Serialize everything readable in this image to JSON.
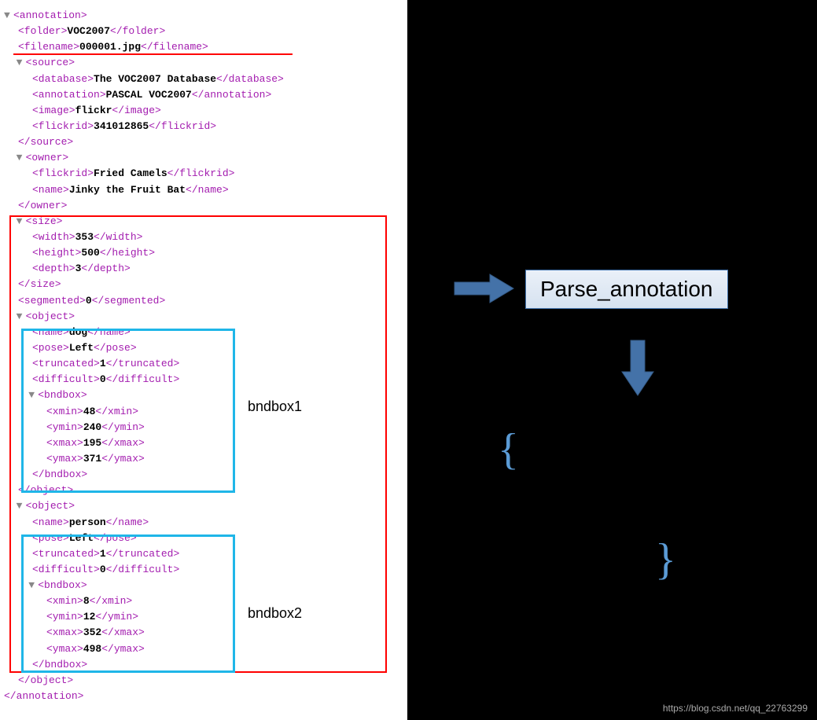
{
  "xml": {
    "root": {
      "open": "<annotation>",
      "close": "</annotation>"
    },
    "folder": {
      "open": "<folder>",
      "val": "VOC2007",
      "close": "</folder>"
    },
    "filename": {
      "open": "<filename>",
      "val": "000001.jpg",
      "close": "</filename>"
    },
    "source": {
      "open": "<source>",
      "close": "</source>",
      "database": {
        "open": "<database>",
        "val": "The VOC2007 Database",
        "close": "</database>"
      },
      "annotation": {
        "open": "<annotation>",
        "val": "PASCAL VOC2007",
        "close": "</annotation>"
      },
      "image": {
        "open": "<image>",
        "val": "flickr",
        "close": "</image>"
      },
      "flickrid": {
        "open": "<flickrid>",
        "val": "341012865",
        "close": "</flickrid>"
      }
    },
    "owner": {
      "open": "<owner>",
      "close": "</owner>",
      "flickrid": {
        "open": "<flickrid>",
        "val": "Fried Camels",
        "close": "</flickrid>"
      },
      "name": {
        "open": "<name>",
        "val": "Jinky the Fruit Bat",
        "close": "</name>"
      }
    },
    "size": {
      "open": "<size>",
      "close": "</size>",
      "width": {
        "open": "<width>",
        "val": "353",
        "close": "</width>"
      },
      "height": {
        "open": "<height>",
        "val": "500",
        "close": "</height>"
      },
      "depth": {
        "open": "<depth>",
        "val": "3",
        "close": "</depth>"
      }
    },
    "segmented": {
      "open": "<segmented>",
      "val": "0",
      "close": "</segmented>"
    },
    "object1": {
      "open": "<object>",
      "close": "</object>",
      "name": {
        "open": "<name>",
        "val": "dog",
        "close": "</name>"
      },
      "pose": {
        "open": "<pose>",
        "val": "Left",
        "close": "</pose>"
      },
      "truncated": {
        "open": "<truncated>",
        "val": "1",
        "close": "</truncated>"
      },
      "difficult": {
        "open": "<difficult>",
        "val": "0",
        "close": "</difficult>"
      },
      "bndbox": {
        "open": "<bndbox>",
        "close": "</bndbox>",
        "xmin": {
          "open": "<xmin>",
          "val": "48",
          "close": "</xmin>"
        },
        "ymin": {
          "open": "<ymin>",
          "val": "240",
          "close": "</ymin>"
        },
        "xmax": {
          "open": "<xmax>",
          "val": "195",
          "close": "</xmax>"
        },
        "ymax": {
          "open": "<ymax>",
          "val": "371",
          "close": "</ymax>"
        }
      }
    },
    "object2": {
      "open": "<object>",
      "close": "</object>",
      "name": {
        "open": "<name>",
        "val": "person",
        "close": "</name>"
      },
      "pose": {
        "open": "<pose>",
        "val": "Left",
        "close": "</pose>"
      },
      "truncated": {
        "open": "<truncated>",
        "val": "1",
        "close": "</truncated>"
      },
      "difficult": {
        "open": "<difficult>",
        "val": "0",
        "close": "</difficult>"
      },
      "bndbox": {
        "open": "<bndbox>",
        "close": "</bndbox>",
        "xmin": {
          "open": "<xmin>",
          "val": "8",
          "close": "</xmin>"
        },
        "ymin": {
          "open": "<ymin>",
          "val": "12",
          "close": "</ymin>"
        },
        "xmax": {
          "open": "<xmax>",
          "val": "352",
          "close": "</xmax>"
        },
        "ymax": {
          "open": "<ymax>",
          "val": "498",
          "close": "</ymax>"
        }
      }
    }
  },
  "labels": {
    "bnd1": "bndbox1",
    "bnd2": "bndbox2",
    "parse": "Parse_annotation"
  },
  "watermark": "https://blog.csdn.net/qq_22763299"
}
